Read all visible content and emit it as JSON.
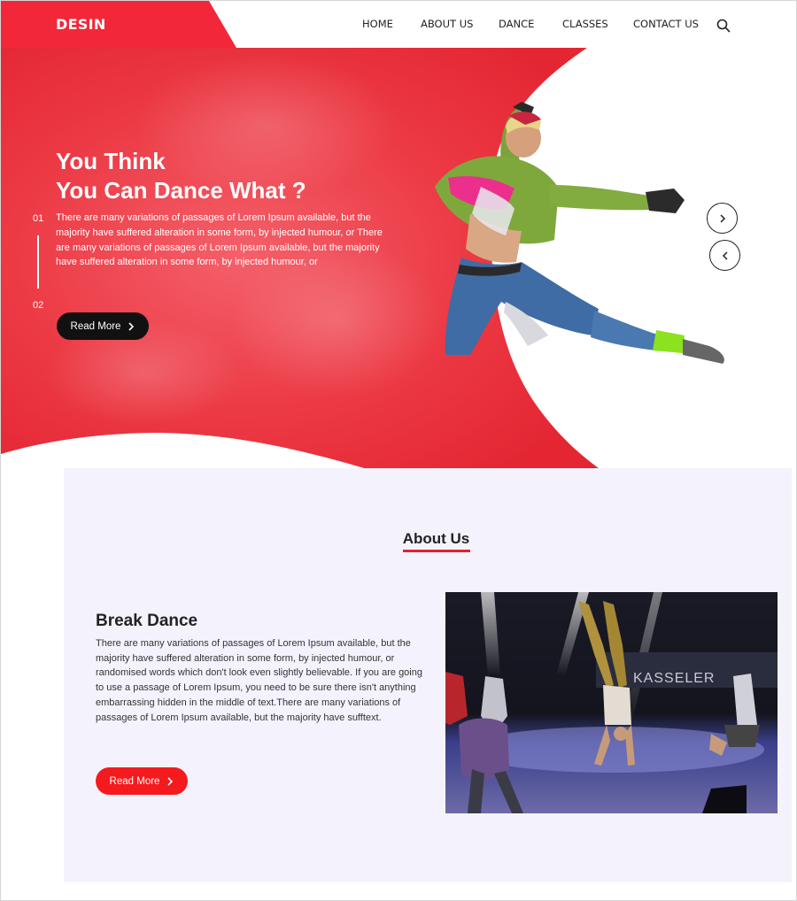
{
  "brand": {
    "logo": "DESIN",
    "accent": "#ef2a36",
    "dark": "#111111",
    "button_red": "#f51a1e",
    "panel_bg": "#f4f3fd"
  },
  "nav": {
    "items": [
      {
        "label": "HOME"
      },
      {
        "label": "ABOUT US"
      },
      {
        "label": "DANCE"
      },
      {
        "label": "CLASSES"
      },
      {
        "label": "CONTACT US"
      }
    ],
    "search_icon": "search-icon"
  },
  "hero": {
    "title_line1": "You Think",
    "title_line2": "You Can Dance What ?",
    "text": "There are many variations of passages of Lorem Ipsum available, but the majority have suffered alteration in some form, by injected humour, or There are many variations of passages of Lorem Ipsum available, but the majority have suffered alteration in some form, by injected humour, or",
    "slide_numbers": [
      "01",
      "02"
    ],
    "button_label": "Read More",
    "next_icon": "chevron-right-icon",
    "prev_icon": "chevron-left-icon"
  },
  "about": {
    "heading": "About Us",
    "title": "Break Dance",
    "text": "There are many variations of passages of Lorem Ipsum available, but the majority have suffered alteration in some form, by injected humour, or randomised words which don't look even slightly believable. If you are going to use a passage of Lorem Ipsum, you need to be sure there isn't anything embarrassing hidden in the middle of text.There are many variations of passages of Lorem Ipsum available, but the majority have sufftext.",
    "button_label": "Read More",
    "photo_banner_text": "KASSELER"
  }
}
